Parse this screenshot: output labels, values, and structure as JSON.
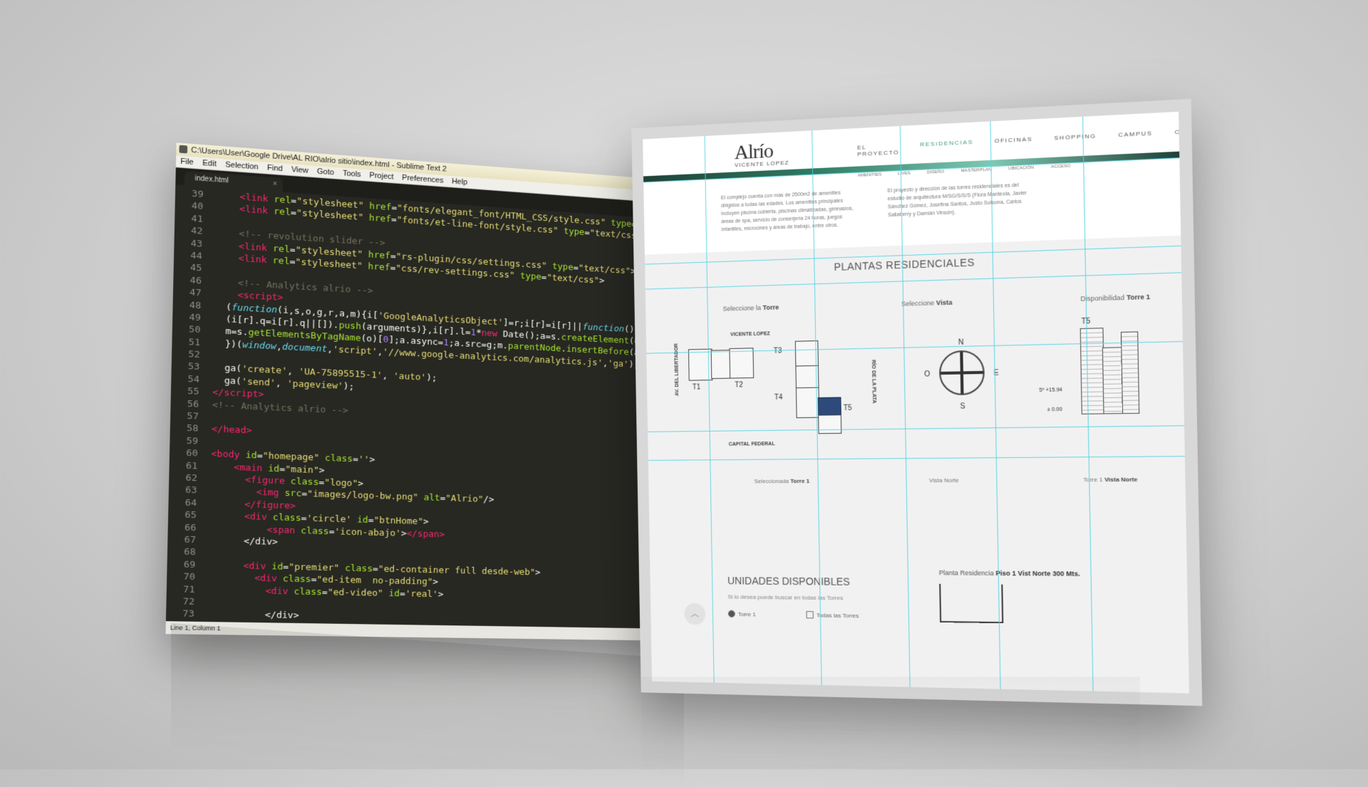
{
  "editor": {
    "title": "C:\\Users\\User\\Google Drive\\AL RIO\\alrio sitio\\index.html - Sublime Text 2",
    "menu": [
      "File",
      "Edit",
      "Selection",
      "Find",
      "View",
      "Goto",
      "Tools",
      "Project",
      "Preferences",
      "Help"
    ],
    "tab_label": "index.html",
    "tab_close": "×",
    "status": "Line 1, Column 1",
    "lines": [
      {
        "n": "39",
        "html": "    <span class='t-tag'>&lt;link</span> <span class='t-attr'>rel</span>=<span class='t-str'>\"stylesheet\"</span> <span class='t-attr'>href</span>=<span class='t-str'>\"fonts/elegant_font/HTML_CSS/style.css\"</span> <span class='t-attr'>type</span>="
      },
      {
        "n": "40",
        "html": "    <span class='t-tag'>&lt;link</span> <span class='t-attr'>rel</span>=<span class='t-str'>\"stylesheet\"</span> <span class='t-attr'>href</span>=<span class='t-str'>\"fonts/et-line-font/style.css\"</span> <span class='t-attr'>type</span>=<span class='t-str'>\"text/css\"</span>"
      },
      {
        "n": "41",
        "html": ""
      },
      {
        "n": "42",
        "html": "    <span class='t-com'>&lt;!-- revolution slider --&gt;</span>"
      },
      {
        "n": "43",
        "html": "    <span class='t-tag'>&lt;link</span> <span class='t-attr'>rel</span>=<span class='t-str'>\"stylesheet\"</span> <span class='t-attr'>href</span>=<span class='t-str'>\"rs-plugin/css/settings.css\"</span> <span class='t-attr'>type</span>=<span class='t-str'>\"text/css\"</span>&gt;"
      },
      {
        "n": "44",
        "html": "    <span class='t-tag'>&lt;link</span> <span class='t-attr'>rel</span>=<span class='t-str'>\"stylesheet\"</span> <span class='t-attr'>href</span>=<span class='t-str'>\"css/rev-settings.css\"</span> <span class='t-attr'>type</span>=<span class='t-str'>\"text/css\"</span>&gt;"
      },
      {
        "n": "45",
        "html": ""
      },
      {
        "n": "46",
        "html": "    <span class='t-com'>&lt;!-- Analytics alrio --&gt;</span>"
      },
      {
        "n": "47",
        "html": "    <span class='t-tag'>&lt;script&gt;</span>"
      },
      {
        "n": "48",
        "html": "  (<span class='t-fn'>function</span>(i,s,o,g,r,a,m){i[<span class='t-str'>'GoogleAnalyticsObject'</span>]=r;i[r]=i[r]||<span class='t-fn'>function</span>(){"
      },
      {
        "n": "49",
        "html": "  (i[r].q=i[r].q||[]).<span class='t-attr'>push</span>(arguments)},i[r].l=<span class='t-num'>1</span>*<span class='t-tag'>new</span> Date();a=s.<span class='t-attr'>createElement</span>(o),"
      },
      {
        "n": "50",
        "html": "  m=s.<span class='t-attr'>getElementsByTagName</span>(o)[<span class='t-num'>0</span>];a.async=<span class='t-num'>1</span>;a.src=g;m.<span class='t-attr'>parentNode</span>.<span class='t-attr'>insertBefore</span>(a,"
      },
      {
        "n": "51",
        "html": "  })(<span class='t-fn'>window</span>,<span class='t-fn'>document</span>,<span class='t-str'>'script'</span>,<span class='t-str'>'//www.google-analytics.com/analytics.js'</span>,<span class='t-str'>'ga'</span>);"
      },
      {
        "n": "52",
        "html": ""
      },
      {
        "n": "53",
        "html": "  ga(<span class='t-str'>'create'</span>, <span class='t-str'>'UA-75895515-1'</span>, <span class='t-str'>'auto'</span>);"
      },
      {
        "n": "54",
        "html": "  ga(<span class='t-str'>'send'</span>, <span class='t-str'>'pageview'</span>);"
      },
      {
        "n": "55",
        "html": "<span class='t-tag'>&lt;/script&gt;</span>"
      },
      {
        "n": "56",
        "html": "<span class='t-com'>&lt;!-- Analytics alrio --&gt;</span>"
      },
      {
        "n": "57",
        "html": ""
      },
      {
        "n": "58",
        "html": "<span class='t-tag'>&lt;/head&gt;</span>"
      },
      {
        "n": "59",
        "html": ""
      },
      {
        "n": "60",
        "html": "<span class='t-tag'>&lt;body</span> <span class='t-attr'>id</span>=<span class='t-str'>\"homepage\"</span> <span class='t-attr'>class</span>=<span class='t-str'>''</span>&gt;"
      },
      {
        "n": "61",
        "html": "    <span class='t-tag'>&lt;main</span> <span class='t-attr'>id</span>=<span class='t-str'>\"main\"</span>&gt;"
      },
      {
        "n": "62",
        "html": "      <span class='t-tag'>&lt;figure</span> <span class='t-attr'>class</span>=<span class='t-str'>\"logo\"</span>&gt;"
      },
      {
        "n": "63",
        "html": "        <span class='t-tag'>&lt;img</span> <span class='t-attr'>src</span>=<span class='t-str'>\"images/logo-bw.png\"</span> <span class='t-attr'>alt</span>=<span class='t-str'>\"Alrio\"</span>/&gt;"
      },
      {
        "n": "64",
        "html": "      <span class='t-tag'>&lt;/figure&gt;</span>"
      },
      {
        "n": "65",
        "html": "      <span class='t-tag'>&lt;div</span> <span class='t-attr'>class</span>=<span class='t-str'>'circle'</span> <span class='t-attr'>id</span>=<span class='t-str'>\"btnHome\"</span>&gt;"
      },
      {
        "n": "66",
        "html": "          <span class='t-tag'>&lt;span</span> <span class='t-attr'>class</span>=<span class='t-str'>'icon-abajo'</span>&gt;<span class='t-tag'>&lt;/span&gt;</span>"
      },
      {
        "n": "67",
        "html": "      &lt;/div&gt;"
      },
      {
        "n": "68",
        "html": ""
      },
      {
        "n": "69",
        "html": "      <span class='t-tag'>&lt;div</span> <span class='t-attr'>id</span>=<span class='t-str'>\"premier\"</span> <span class='t-attr'>class</span>=<span class='t-str'>\"ed-container full desde-web\"</span>&gt;"
      },
      {
        "n": "70",
        "html": "        <span class='t-tag'>&lt;div</span> <span class='t-attr'>class</span>=<span class='t-str'>\"ed-item  no-padding\"</span>&gt;"
      },
      {
        "n": "71",
        "html": "          <span class='t-tag'>&lt;div</span> <span class='t-attr'>class</span>=<span class='t-str'>\"ed-video\"</span> <span class='t-attr'>id</span>=<span class='t-str'>'real'</span>&gt;"
      },
      {
        "n": "72",
        "html": ""
      },
      {
        "n": "73",
        "html": "          &lt;/div&gt;"
      }
    ]
  },
  "site": {
    "logo_mark": "Alrío",
    "logo_sub": "VICENTE LOPEZ",
    "nav": [
      "EL PROYECTO",
      "RESIDENCIAS",
      "OFICINAS",
      "SHOPPING",
      "CAMPUS",
      "CONTACTO"
    ],
    "nav_active": "RESIDENCIAS",
    "subnav": [
      "AMENITIES",
      "LIVES",
      "DISEÑO",
      "MASTERPLAN",
      "UBICACIÓN",
      "ACCESO"
    ],
    "intro_left": "El complejo cuenta con más de 2500m2 de amenities dirigidos a todas las edades. Los amenities principales incluyen piscina cubierta, piscinas climatizadas, gimnasios, áreas de spa, servicio de conserjería 24 horas, juegos infantiles, microcines y áreas de trabajo, entre otros.",
    "intro_right": "El proyecto y dirección de las torres residenciales es del estudio de arquitectura M/SG/S/S/S (Flora Manteola, Javier Sánchez Gómez, Josefina Santos, Justo Solsona, Carlos Sallaberry y Damián Vinsón).",
    "section_title": "PLANTAS RESIDENCIALES",
    "pick_tower": "Seleccione la",
    "pick_tower_b": "Torre",
    "pick_view": "Seleccione",
    "pick_view_b": "Vista",
    "avail": "Disponibilidad",
    "avail_b": "Torre 1",
    "street_top": "VICENTE LOPEZ",
    "street_bottom": "CAPITAL FEDERAL",
    "street_left": "AV. DEL LIBERTADOR",
    "street_right": "RÍO DE LA PLATA",
    "towers": [
      "T1",
      "T2",
      "T3",
      "T4",
      "T5"
    ],
    "compass": {
      "n": "N",
      "s": "S",
      "e": "E",
      "o": "O"
    },
    "elev_label": "T5",
    "elev_level_1": "5º +15.94",
    "elev_level_0": "± 0.00",
    "cap_sel": "Seleccionada",
    "cap_sel_b": "Torre 1",
    "cap_view": "Vista Norte",
    "cap_tower": "Torre 1",
    "cap_tower_b": "Vista Norte",
    "planta_label": "Planta Residencia",
    "planta_b": "Piso 1 Vist Norte 300 Mts.",
    "unidades_title": "UNIDADES DISPONIBLES",
    "unidades_hint": "Si lo desea puede buscar en todas las Torres",
    "radio_1": "Torre 1",
    "radio_2": "Todas las Torres",
    "scroll_icon": "︿"
  }
}
